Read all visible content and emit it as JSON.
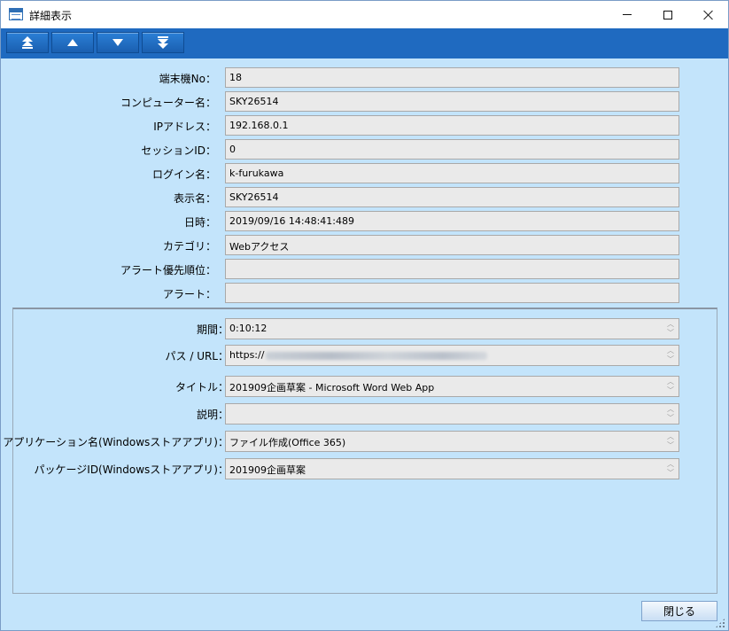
{
  "window": {
    "title": "詳細表示",
    "controls": {
      "minimize": "minimize",
      "maximize": "maximize",
      "close": "close"
    }
  },
  "toolbar": {
    "buttons": [
      {
        "icon": "double-up-arrow-icon"
      },
      {
        "icon": "up-arrow-icon"
      },
      {
        "icon": "down-arrow-icon"
      },
      {
        "icon": "double-down-arrow-icon"
      }
    ]
  },
  "form": {
    "terminal_no": {
      "label": "端末機No：",
      "value": "18"
    },
    "computer_name": {
      "label": "コンピューター名：",
      "value": "SKY26514"
    },
    "ip_address": {
      "label": "IPアドレス：",
      "value": "192.168.0.1"
    },
    "session_id": {
      "label": "セッションID：",
      "value": "0"
    },
    "login_name": {
      "label": "ログイン名：",
      "value": "k-furukawa"
    },
    "display_name": {
      "label": "表示名：",
      "value": "SKY26514"
    },
    "datetime": {
      "label": "日時：",
      "value": "2019/09/16 14:48:41:489"
    },
    "category": {
      "label": "カテゴリ：",
      "value": "Webアクセス"
    },
    "alert_priority": {
      "label": "アラート優先順位：",
      "value": ""
    },
    "alert": {
      "label": "アラート：",
      "value": ""
    }
  },
  "details": {
    "period": {
      "label": "期間：",
      "value": "0:10:12"
    },
    "path_url": {
      "label": "パス / URL：",
      "value": "https://"
    },
    "title": {
      "label": "タイトル：",
      "value": "201909企画草案 - Microsoft Word Web App"
    },
    "description": {
      "label": "説明：",
      "value": ""
    },
    "app_name": {
      "label": "アプリケーション名(Windowsストアアプリ)：",
      "value": "ファイル作成(Office 365)"
    },
    "package_id": {
      "label": "パッケージID(Windowsストアアプリ)：",
      "value": "201909企画草案"
    }
  },
  "footer": {
    "close_label": "閉じる"
  },
  "colors": {
    "toolbar": "#1f6ac0",
    "background": "#c3e4fb",
    "field": "#eaeaea"
  }
}
